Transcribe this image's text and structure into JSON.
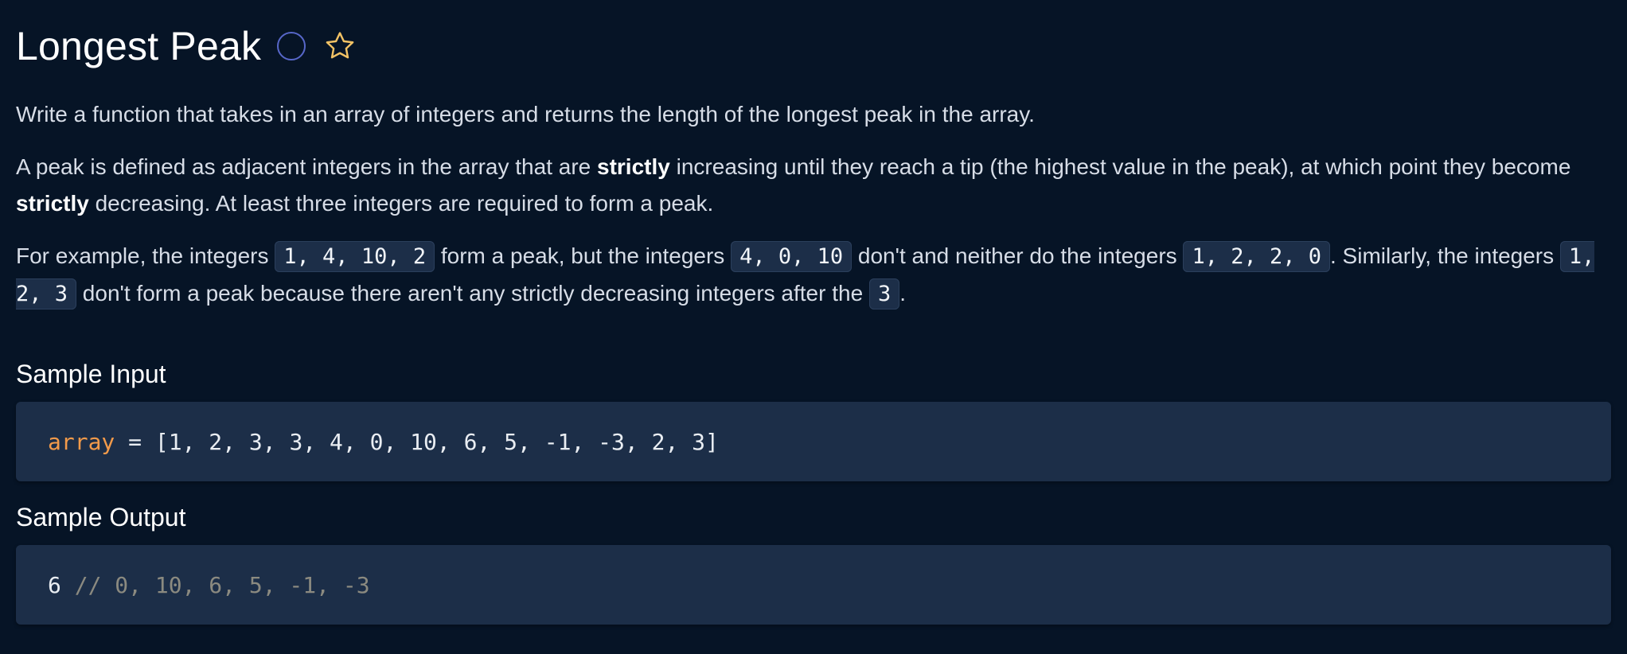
{
  "title": "Longest Peak",
  "icons": {
    "status": "status-circle-icon",
    "favorite": "star-icon",
    "status_color": "#5767c9",
    "star_color": "#f2c265"
  },
  "description": {
    "p1": "Write a function that takes in an array of integers and returns the length of the longest peak in the array.",
    "p2": {
      "t1": "A peak is defined as adjacent integers in the array that are ",
      "b1": "strictly",
      "t2": " increasing until they reach a tip (the highest value in the peak), at which point they become ",
      "b2": "strictly",
      "t3": " decreasing. At least three integers are required to form a peak."
    },
    "p3": {
      "t1": "For example, the integers ",
      "c1": "1, 4, 10, 2",
      "t2": " form a peak, but the integers ",
      "c2": "4, 0, 10",
      "t3": " don't and neither do the integers ",
      "c3": "1, 2, 2, 0",
      "t4": ". Similarly, the integers ",
      "c4": "1, 2, 3",
      "t5": " don't form a peak because there aren't any strictly decreasing integers after the ",
      "c5": "3",
      "t6": "."
    }
  },
  "sample_input": {
    "heading": "Sample Input",
    "var": "array",
    "rest": " = [1, 2, 3, 3, 4, 0, 10, 6, 5, -1, -3, 2, 3]"
  },
  "sample_output": {
    "heading": "Sample Output",
    "value": "6",
    "comment": " // 0, 10, 6, 5, -1, -3"
  },
  "colors": {
    "background": "#061426",
    "code_background": "#1c2e48",
    "variable": "#f29a4a",
    "comment": "#8b8a80"
  }
}
